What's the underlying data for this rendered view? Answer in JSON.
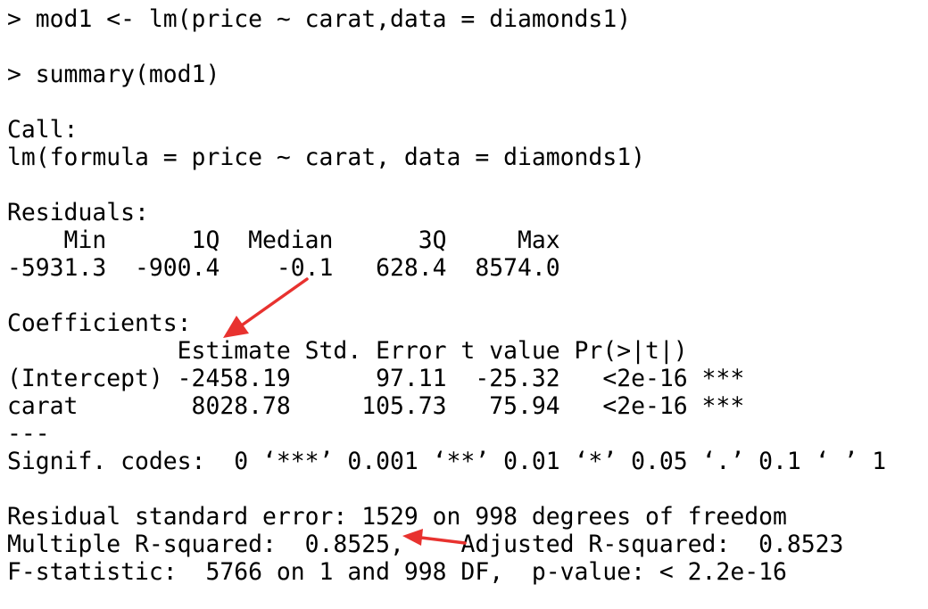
{
  "console": {
    "lines": [
      "> mod1 <- lm(price ~ carat,data = diamonds1)",
      "",
      "> summary(mod1)",
      "",
      "Call:",
      "lm(formula = price ~ carat, data = diamonds1)",
      "",
      "Residuals:",
      "    Min      1Q  Median      3Q     Max ",
      "-5931.3  -900.4    -0.1   628.4  8574.0 ",
      "",
      "Coefficients:",
      "            Estimate Std. Error t value Pr(>|t|)    ",
      "(Intercept) -2458.19      97.11  -25.32   <2e-16 ***",
      "carat        8028.78     105.73   75.94   <2e-16 ***",
      "---",
      "Signif. codes:  0 ‘***’ 0.001 ‘**’ 0.01 ‘*’ 0.05 ‘.’ 0.1 ‘ ’ 1",
      "",
      "Residual standard error: 1529 on 998 degrees of freedom",
      "Multiple R-squared:  0.8525,\tAdjusted R-squared:  0.8523 ",
      "F-statistic:  5766 on 1 and 998 DF,  p-value: < 2.2e-16"
    ]
  },
  "annotations": {
    "arrow_color": "#e8322f"
  }
}
